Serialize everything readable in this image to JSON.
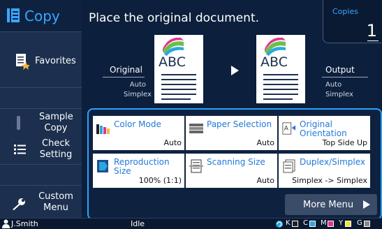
{
  "sidebar": {
    "title": "Copy",
    "favorites": "Favorites",
    "sample_copy": [
      "Sample",
      "Copy"
    ],
    "check_setting": [
      "Check",
      "Setting"
    ],
    "custom_menu": [
      "Custom",
      "Menu"
    ]
  },
  "header": {
    "message": "Place the original document.",
    "copies_label": "Copies",
    "copies_value": "1",
    "original": {
      "label": "Original",
      "line1": "Auto",
      "line2": "Simplex",
      "doc_text": "ABC"
    },
    "output": {
      "label": "Output",
      "line1": "Auto",
      "line2": "Simplex",
      "doc_text": "ABC"
    }
  },
  "functions": [
    {
      "name": "Color Mode",
      "value": "Auto"
    },
    {
      "name": "Paper Selection",
      "value": "Auto"
    },
    {
      "name": [
        "Original",
        "Orientation"
      ],
      "value": "Top Side Up"
    },
    {
      "name": "Reproduction Size",
      "value": "100% (1:1)"
    },
    {
      "name": "Scanning Size",
      "value": "Auto"
    },
    {
      "name": "Duplex/Simplex",
      "value": "Simplex -> Simplex"
    }
  ],
  "more_menu": "More Menu",
  "status": {
    "user": "J.Smith",
    "state": "Idle",
    "inks": [
      {
        "label": "K",
        "color": "#222222"
      },
      {
        "label": "C",
        "color": "#29a8e0"
      },
      {
        "label": "M",
        "color": "#e0368c"
      },
      {
        "label": "Y",
        "color": "#f5e03a"
      },
      {
        "label": "G",
        "color": "#888888"
      }
    ]
  },
  "colors": {
    "accent": "#2aa3ff",
    "background": "#0c1f3c",
    "sidebar": "#1c2f4e"
  }
}
